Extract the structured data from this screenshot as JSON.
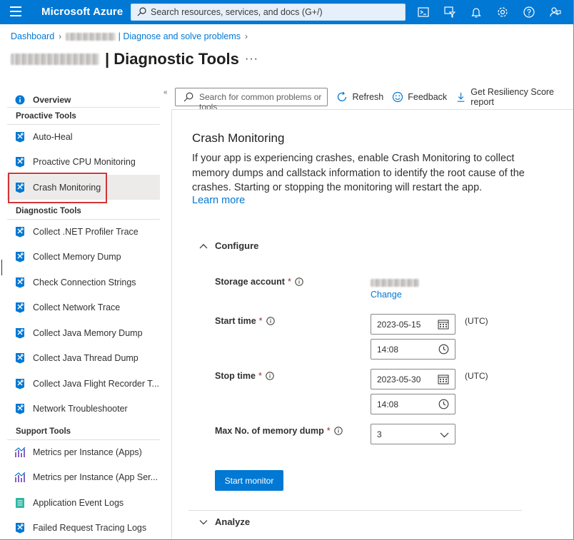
{
  "topbar": {
    "brand": "Microsoft Azure",
    "search_placeholder": "Search resources, services, and docs (G+/)",
    "icons": [
      "cloud-shell-icon",
      "directory-filter-icon",
      "notifications-icon",
      "settings-icon",
      "help-icon",
      "feedback-icon"
    ]
  },
  "breadcrumb": {
    "items": [
      "Dashboard",
      "| Diagnose and solve problems"
    ]
  },
  "page": {
    "title": "| Diagnostic Tools",
    "more": "···"
  },
  "nav": {
    "overview": "Overview",
    "sections": {
      "proactive": "Proactive Tools",
      "diagnostic": "Diagnostic Tools",
      "support": "Support Tools"
    },
    "proactive_items": [
      "Auto-Heal",
      "Proactive CPU Monitoring",
      "Crash Monitoring"
    ],
    "diagnostic_items": [
      "Collect .NET Profiler Trace",
      "Collect Memory Dump",
      "Check Connection Strings",
      "Collect Network Trace",
      "Collect Java Memory Dump",
      "Collect Java Thread Dump",
      "Collect Java Flight Recorder T...",
      "Network Troubleshooter"
    ],
    "support_items": [
      "Metrics per Instance (Apps)",
      "Metrics per Instance (App Ser...",
      "Application Event Logs",
      "Failed Request Tracing Logs"
    ],
    "collapse_icon": "«"
  },
  "toolbar": {
    "search_placeholder": "Search for common problems or tools",
    "refresh": "Refresh",
    "feedback": "Feedback",
    "resiliency": "Get Resiliency Score report"
  },
  "content": {
    "title": "Crash Monitoring",
    "description": "If your app is experiencing crashes, enable Crash Monitoring to collect memory dumps and callstack information to identify the root cause of the crashes. Starting or stopping the monitoring will restart the app.",
    "learn_more": "Learn more"
  },
  "configure": {
    "header": "Configure",
    "storage_label": "Storage account",
    "storage_change": "Change",
    "start_label": "Start time",
    "start_date": "2023-05-15",
    "start_time": "14:08",
    "stop_label": "Stop time",
    "stop_date": "2023-05-30",
    "stop_time": "14:08",
    "utc": "(UTC)",
    "max_label": "Max No. of memory dump",
    "max_value": "3",
    "required": "*",
    "start_button": "Start monitor"
  },
  "analyze": {
    "header": "Analyze"
  },
  "colors": {
    "accent": "#0078d4",
    "selected_bg": "#edebe9",
    "highlight_box": "#d13438"
  }
}
